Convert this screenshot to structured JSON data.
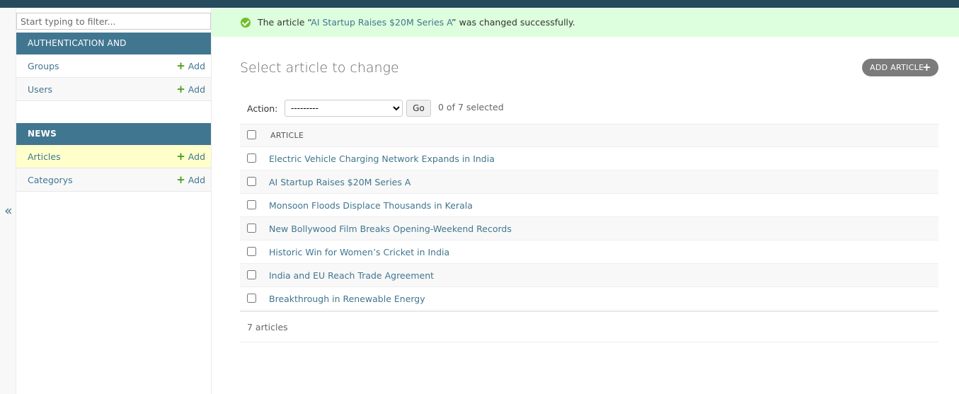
{
  "sidebar": {
    "filter_placeholder": "Start typing to filter...",
    "collapse_glyph": "«",
    "modules": [
      {
        "caption": "AUTHENTICATION AND AUTHORIZATION",
        "items": [
          {
            "label": "Groups",
            "add": "Add"
          },
          {
            "label": "Users",
            "add": "Add"
          }
        ]
      },
      {
        "caption": "NEWS",
        "items": [
          {
            "label": "Articles",
            "add": "Add"
          },
          {
            "label": "Categorys",
            "add": "Add"
          }
        ]
      }
    ]
  },
  "message": {
    "prefix": "The article “",
    "link": "AI Startup Raises $20M Series A",
    "suffix": "” was changed successfully."
  },
  "page": {
    "title": "Select article to change",
    "add_button": "ADD ARTICLE"
  },
  "actions": {
    "label": "Action:",
    "selected_option": "---------",
    "go": "Go",
    "count": "0 of 7 selected"
  },
  "table": {
    "header": "ARTICLE",
    "rows": [
      "Electric Vehicle Charging Network Expands in India",
      "AI Startup Raises $20M Series A",
      "Monsoon Floods Displace Thousands in Kerala",
      "New Bollywood Film Breaks Opening-Weekend Records",
      "Historic Win for Women’s Cricket in India",
      "India and EU Reach Trade Agreement",
      "Breakthrough in Renewable Energy"
    ],
    "footer": "7 articles"
  },
  "colors": {
    "header_bar": "#264b5d",
    "module_caption": "#417690",
    "link": "#417690",
    "success_bg": "#ddffdd",
    "add_plus": "#4a9a1c"
  }
}
